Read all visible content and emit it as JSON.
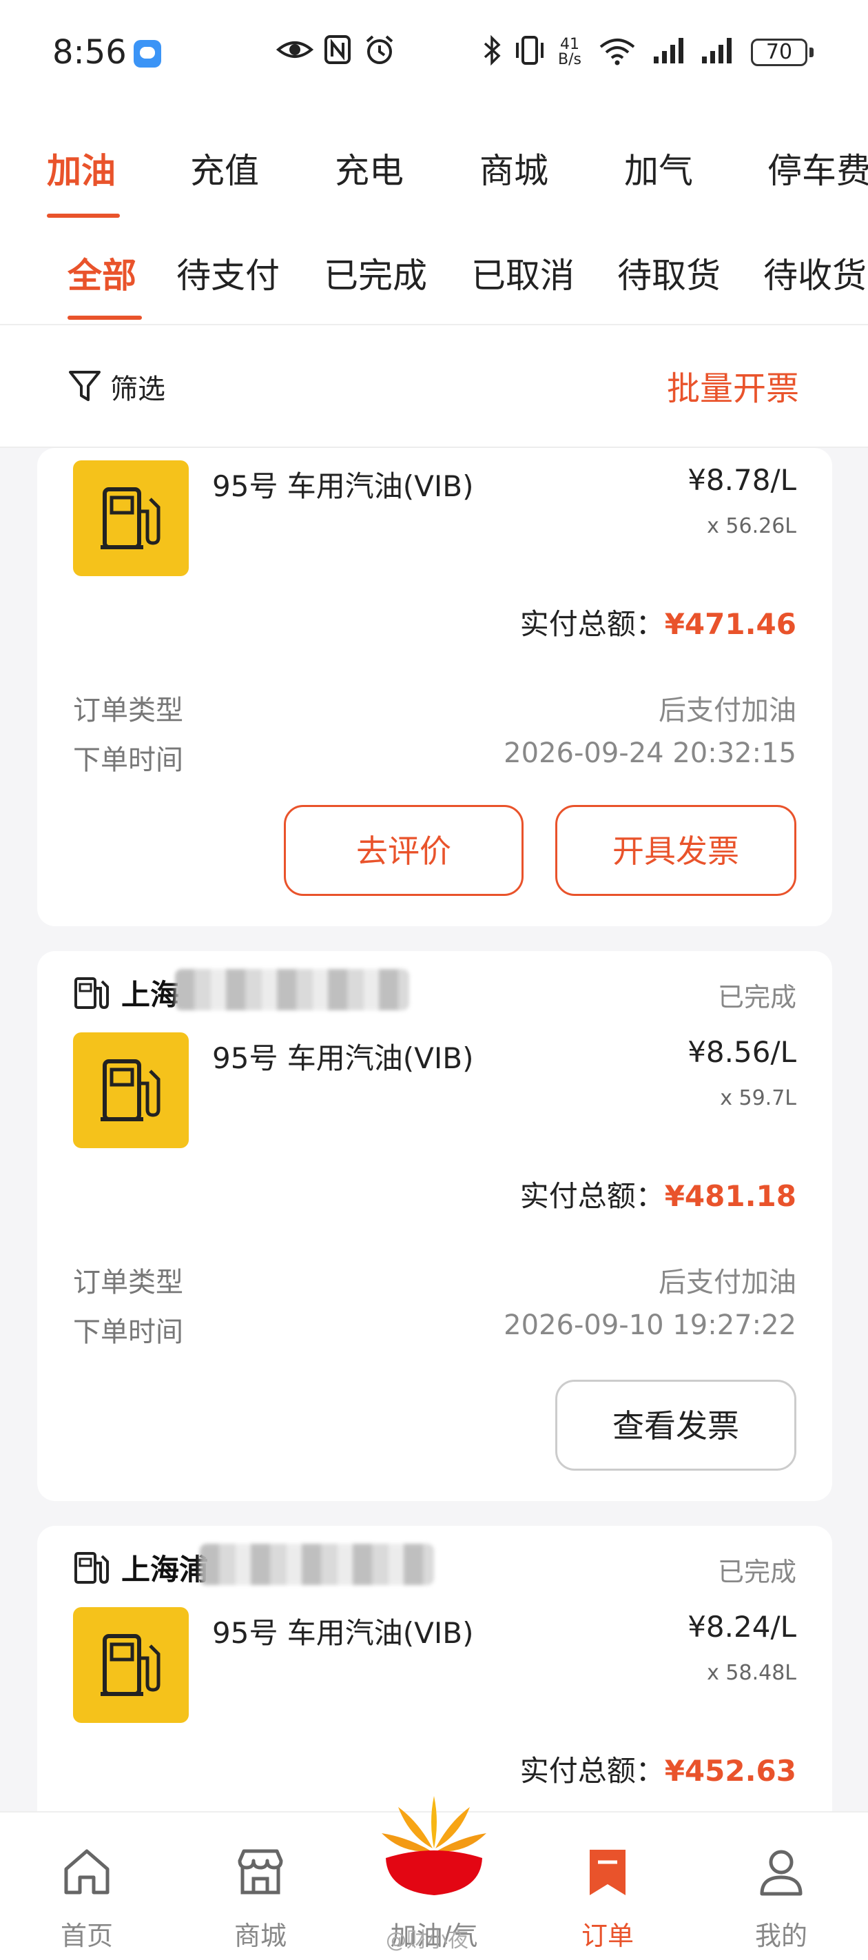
{
  "status_bar": {
    "time": "8:56",
    "net_speed_top": "41",
    "net_speed_bottom": "B/s",
    "battery": "70",
    "icons": [
      "message-icon",
      "eye-icon",
      "nfc-icon",
      "alarm-icon",
      "bluetooth-icon",
      "vibrate-icon",
      "wifi-icon",
      "signal-icon",
      "signal-icon",
      "battery-icon"
    ]
  },
  "main_tabs": [
    {
      "label": "加油",
      "active": true
    },
    {
      "label": "充值"
    },
    {
      "label": "充电"
    },
    {
      "label": "商城"
    },
    {
      "label": "加气"
    },
    {
      "label": "停车费"
    }
  ],
  "sub_tabs": [
    {
      "label": "全部",
      "active": true
    },
    {
      "label": "待支付"
    },
    {
      "label": "已完成"
    },
    {
      "label": "已取消"
    },
    {
      "label": "待取货"
    },
    {
      "label": "待收货"
    }
  ],
  "filter": {
    "label": "筛选",
    "batch_invoice": "批量开票"
  },
  "orders": [
    {
      "product": "95号 车用汽油(VIB)",
      "unit_price": "¥8.78/L",
      "quantity": "x 56.26L",
      "total_label": "实付总额：",
      "total_amount": "¥471.46",
      "type_label": "订单类型",
      "type_value": "后支付加油",
      "time_label": "下单时间",
      "time_value": "2026-09-24 20:32:15",
      "buttons": [
        "去评价",
        "开具发票"
      ]
    },
    {
      "station": "上海",
      "status": "已完成",
      "product": "95号 车用汽油(VIB)",
      "unit_price": "¥8.56/L",
      "quantity": "x 59.7L",
      "total_label": "实付总额：",
      "total_amount": "¥481.18",
      "type_label": "订单类型",
      "type_value": "后支付加油",
      "time_label": "下单时间",
      "time_value": "2026-09-10 19:27:22",
      "buttons": [
        "查看发票"
      ]
    },
    {
      "station": "上海浦",
      "status": "已完成",
      "product": "95号 车用汽油(VIB)",
      "unit_price": "¥8.24/L",
      "quantity": "x 58.48L",
      "total_label": "实付总额：",
      "total_amount": "¥452.63"
    }
  ],
  "bottom_nav": [
    {
      "label": "首页",
      "icon": "home-icon"
    },
    {
      "label": "商城",
      "icon": "store-icon"
    },
    {
      "label": "加油/气",
      "icon": "petrochina-logo"
    },
    {
      "label": "订单",
      "icon": "bookmark-icon",
      "active": true
    },
    {
      "label": "我的",
      "icon": "user-icon"
    }
  ],
  "watermark": "@财小夜",
  "colors": {
    "accent": "#e9532b",
    "fuel_tile": "#f5c21b",
    "background": "#f5f5f7"
  }
}
